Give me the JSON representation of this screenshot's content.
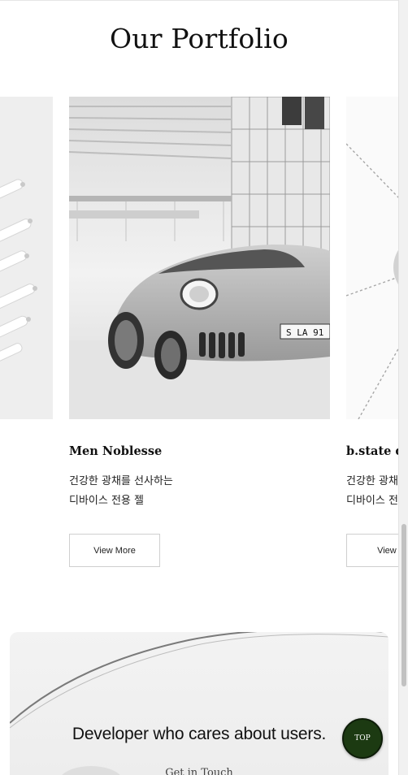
{
  "section": {
    "title": "Our Portfolio"
  },
  "carousel": {
    "items": [
      {
        "name": "",
        "image": "abstract-white-objects"
      },
      {
        "name": "Men Noblesse",
        "desc_line1": "건강한 광채를 선사하는",
        "desc_line2": "디바이스 전용 젤",
        "button": "View More",
        "image": "silver-sports-car"
      },
      {
        "name": "b.state des",
        "desc_line1": "건강한 광채",
        "desc_line2": "디바이스 전",
        "button": "View M",
        "image": "geometric-lines"
      }
    ]
  },
  "banner": {
    "title": "Developer who cares about users.",
    "subtitle": "Get in Touch"
  },
  "top_button": {
    "label": "TOP",
    "color": "#1c3a12"
  },
  "colors": {
    "background": "#ffffff",
    "text": "#111111",
    "button_border": "#cfcfcf"
  }
}
